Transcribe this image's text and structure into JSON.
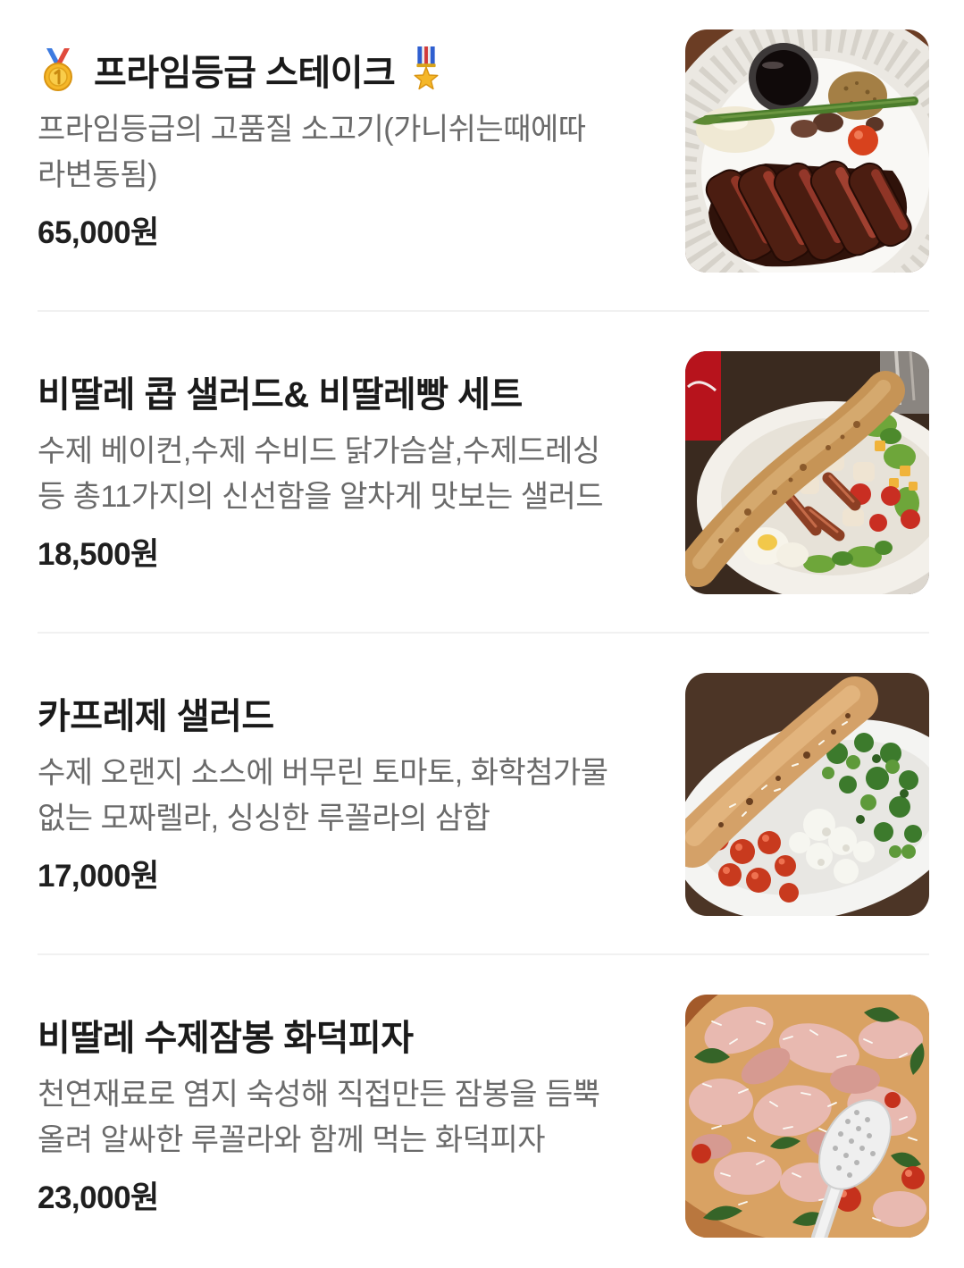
{
  "menu_items": [
    {
      "title": "프라임등급 스테이크",
      "title_icons": {
        "before": "gold-medal-icon",
        "after": "military-medal-icon"
      },
      "description": [
        "프라임등급의 고품질 소고기(가니쉬는때에따",
        "라변동됨)"
      ],
      "price": "65,000원"
    },
    {
      "title": "비딸레 콥 샐러드& 비딸레빵 세트",
      "description": [
        "수제 베이컨,수제 수비드 닭가슴살,수제드레싱",
        "등 총11가지의 신선함을 알차게 맛보는 샐러드"
      ],
      "price": "18,500원"
    },
    {
      "title": "카프레제 샐러드",
      "description": [
        "수제 오랜지 소스에 버무린 토마토, 화학첨가물",
        "없는 모짜렐라, 싱싱한 루꼴라의 삼합"
      ],
      "price": "17,000원"
    },
    {
      "title": "비딸레 수제잠봉 화덕피자",
      "description": [
        "천연재료로 염지 숙성해 직접만든 잠봉을 듬뿍",
        "올려 알싸한 루꼴라와 함께 먹는 화덕피자"
      ],
      "price": "23,000원"
    }
  ]
}
